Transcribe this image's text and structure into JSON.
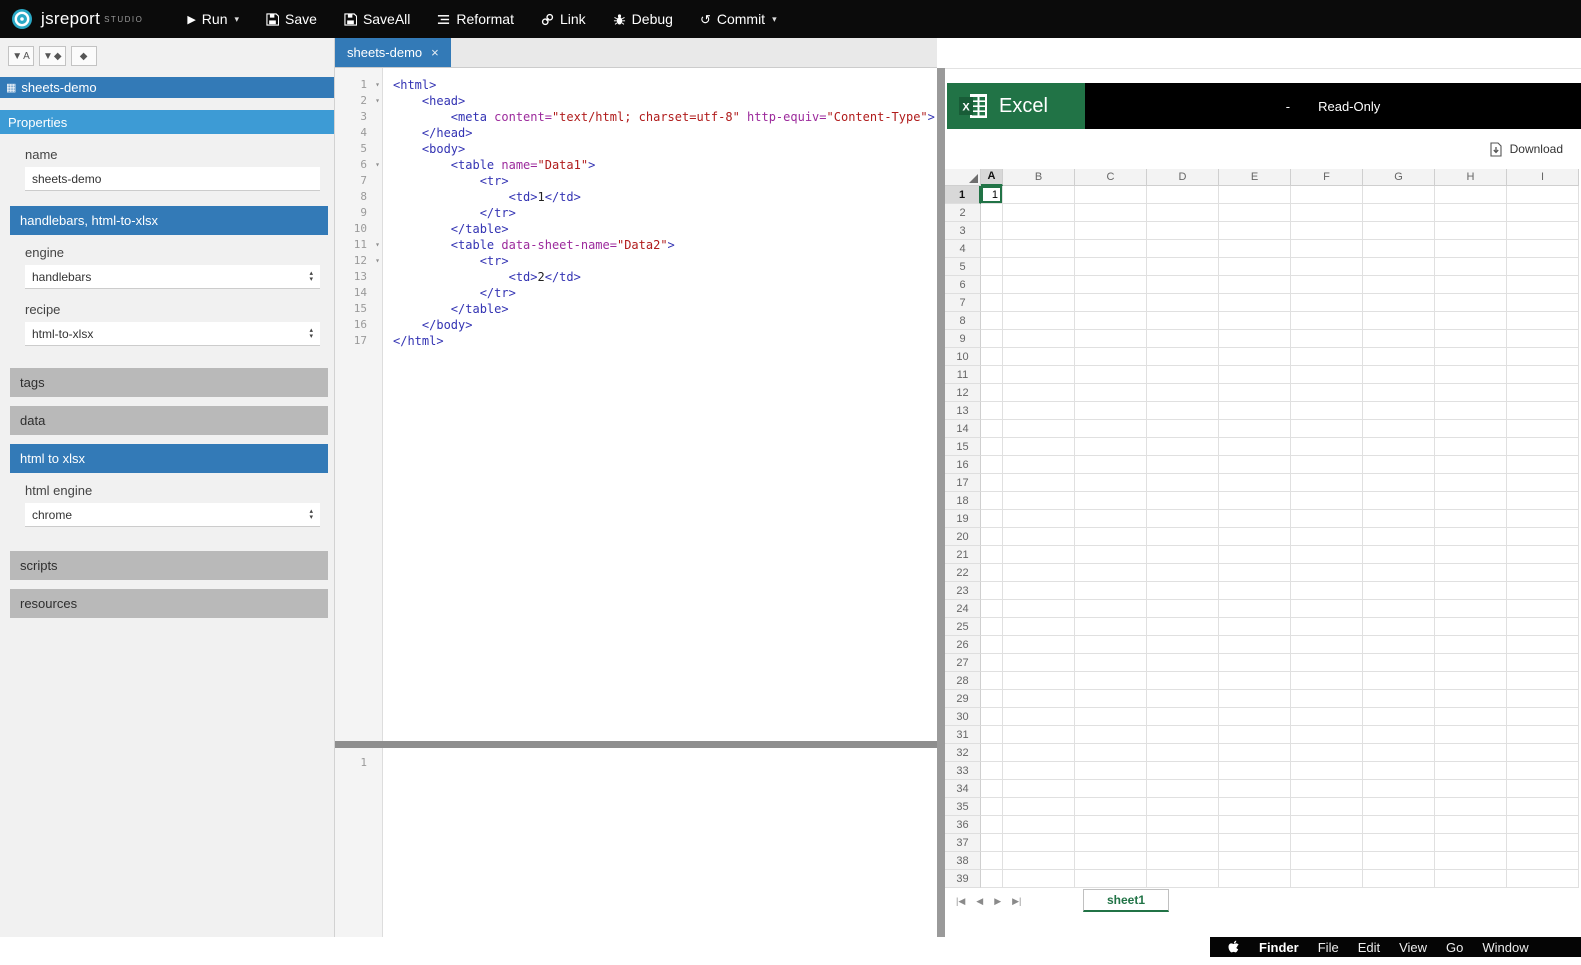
{
  "colors": {
    "studio_blue": "#337ab7",
    "excel_green": "#217346",
    "selection_green": "#217346"
  },
  "topbar": {
    "brand": "jsreport",
    "brand_suffix": "STUDIO",
    "menu": [
      {
        "label": "Run",
        "icon": "play",
        "caret": true
      },
      {
        "label": "Save",
        "icon": "floppy"
      },
      {
        "label": "SaveAll",
        "icon": "floppy"
      },
      {
        "label": "Reformat",
        "icon": "reformat"
      },
      {
        "label": "Link",
        "icon": "link"
      },
      {
        "label": "Debug",
        "icon": "bug"
      },
      {
        "label": "Commit",
        "icon": "commit",
        "caret": true
      }
    ]
  },
  "sidebar": {
    "selected_entity": "sheets-demo",
    "properties": {
      "header": "Properties",
      "name_label": "name",
      "name_value": "sheets-demo"
    },
    "template_section": {
      "header": "handlebars, html-to-xlsx",
      "engine_label": "engine",
      "engine_value": "handlebars",
      "recipe_label": "recipe",
      "recipe_value": "html-to-xlsx"
    },
    "tags_header": "tags",
    "data_header": "data",
    "htmlxlsx_section": {
      "header": "html to xlsx",
      "engine_label": "html engine",
      "engine_value": "chrome"
    },
    "scripts_header": "scripts",
    "resources_header": "resources"
  },
  "editor": {
    "tab": "sheets-demo",
    "close_glyph": "×",
    "helpers_line_number": "1",
    "lines": [
      {
        "n": 1,
        "fold": true,
        "tokens": [
          [
            "<html>",
            "tag"
          ]
        ]
      },
      {
        "n": 2,
        "fold": true,
        "tokens": [
          [
            "    ",
            "pln"
          ],
          [
            "<head>",
            "tag"
          ]
        ]
      },
      {
        "n": 3,
        "fold": false,
        "tokens": [
          [
            "        ",
            "pln"
          ],
          [
            "<meta ",
            "tag"
          ],
          [
            "content=",
            "attr"
          ],
          [
            "\"text/html; charset=utf-8\"",
            "str"
          ],
          [
            " ",
            "pln"
          ],
          [
            "http-equiv=",
            "attr"
          ],
          [
            "\"Content-Type\"",
            "str"
          ],
          [
            ">",
            "tag"
          ]
        ]
      },
      {
        "n": 4,
        "fold": false,
        "tokens": [
          [
            "    ",
            "pln"
          ],
          [
            "</head>",
            "tag"
          ]
        ]
      },
      {
        "n": 5,
        "fold": false,
        "tokens": [
          [
            "    ",
            "pln"
          ],
          [
            "<body>",
            "tag"
          ]
        ]
      },
      {
        "n": 6,
        "fold": true,
        "tokens": [
          [
            "        ",
            "pln"
          ],
          [
            "<table ",
            "tag"
          ],
          [
            "name=",
            "attr"
          ],
          [
            "\"Data1\"",
            "str"
          ],
          [
            ">",
            "tag"
          ]
        ]
      },
      {
        "n": 7,
        "fold": false,
        "tokens": [
          [
            "            ",
            "pln"
          ],
          [
            "<tr>",
            "tag"
          ]
        ]
      },
      {
        "n": 8,
        "fold": false,
        "tokens": [
          [
            "                ",
            "pln"
          ],
          [
            "<td>",
            "tag"
          ],
          [
            "1",
            "pln"
          ],
          [
            "</td>",
            "tag"
          ]
        ]
      },
      {
        "n": 9,
        "fold": false,
        "tokens": [
          [
            "            ",
            "pln"
          ],
          [
            "</tr>",
            "tag"
          ]
        ]
      },
      {
        "n": 10,
        "fold": false,
        "tokens": [
          [
            "        ",
            "pln"
          ],
          [
            "</table>",
            "tag"
          ]
        ]
      },
      {
        "n": 11,
        "fold": true,
        "tokens": [
          [
            "        ",
            "pln"
          ],
          [
            "<table ",
            "tag"
          ],
          [
            "data-sheet-name=",
            "attr"
          ],
          [
            "\"Data2\"",
            "str"
          ],
          [
            ">",
            "tag"
          ]
        ]
      },
      {
        "n": 12,
        "fold": true,
        "tokens": [
          [
            "            ",
            "pln"
          ],
          [
            "<tr>",
            "tag"
          ]
        ]
      },
      {
        "n": 13,
        "fold": false,
        "tokens": [
          [
            "                ",
            "pln"
          ],
          [
            "<td>",
            "tag"
          ],
          [
            "2",
            "pln"
          ],
          [
            "</td>",
            "tag"
          ]
        ]
      },
      {
        "n": 14,
        "fold": false,
        "tokens": [
          [
            "            ",
            "pln"
          ],
          [
            "</tr>",
            "tag"
          ]
        ]
      },
      {
        "n": 15,
        "fold": false,
        "tokens": [
          [
            "        ",
            "pln"
          ],
          [
            "</table>",
            "tag"
          ]
        ]
      },
      {
        "n": 16,
        "fold": false,
        "tokens": [
          [
            "    ",
            "pln"
          ],
          [
            "</body>",
            "tag"
          ]
        ]
      },
      {
        "n": 17,
        "fold": false,
        "tokens": [
          [
            "</html>",
            "tag"
          ]
        ]
      }
    ]
  },
  "preview": {
    "brand": "Excel",
    "readonly_dash": "-",
    "readonly_label": "Read-Only",
    "download_label": "Download",
    "columns": [
      "A",
      "B",
      "C",
      "D",
      "E",
      "F",
      "G",
      "H",
      "I"
    ],
    "row_count": 39,
    "selected_cell": {
      "col": "A",
      "row": 1,
      "value": "1"
    },
    "sheet_tab": "sheet1",
    "nav_icons": [
      "|◀",
      "◀",
      "▶",
      "▶|"
    ]
  },
  "menubar": {
    "items": [
      "Finder",
      "File",
      "Edit",
      "View",
      "Go",
      "Window"
    ]
  }
}
